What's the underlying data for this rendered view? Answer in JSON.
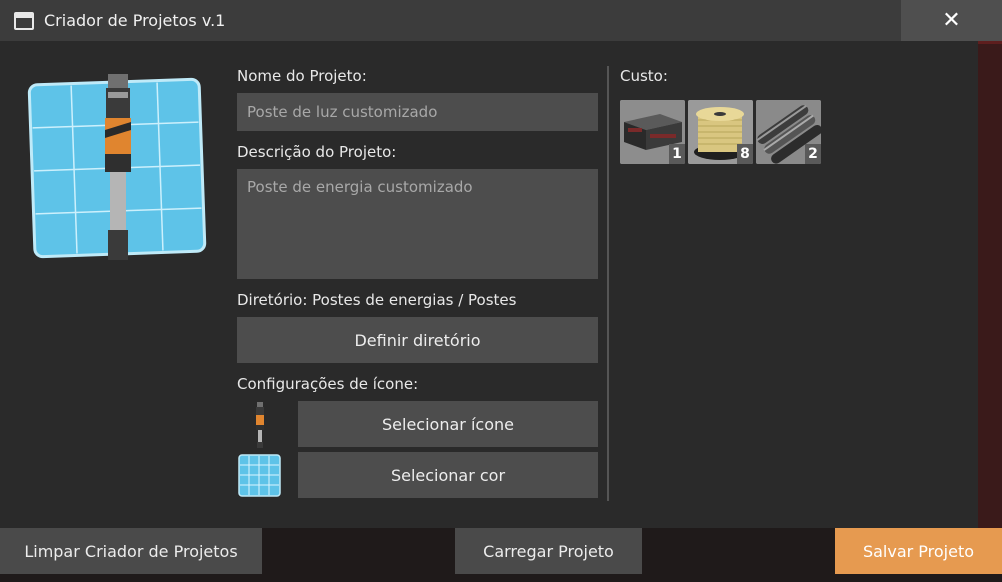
{
  "window": {
    "title": "Criador de Projetos v.1",
    "close_label": "✕"
  },
  "form": {
    "name_label": "Nome do Projeto:",
    "name_value": "Poste de luz customizado",
    "description_label": "Descrição do Projeto:",
    "description_value": "Poste de energia customizado",
    "directory_label": "Diretório: Postes de energias / Postes",
    "define_directory_button": "Definir diretório",
    "icon_settings_label": "Configurações de ícone:",
    "select_icon_button": "Selecionar ícone",
    "select_color_button": "Selecionar cor"
  },
  "cost": {
    "label": "Custo:",
    "items": [
      {
        "icon": "steel-beam-icon",
        "count": "1"
      },
      {
        "icon": "wire-spool-icon",
        "count": "8"
      },
      {
        "icon": "metal-pipes-icon",
        "count": "2"
      }
    ]
  },
  "footer": {
    "clear_button": "Limpar Criador de Projetos",
    "load_button": "Carregar Projeto",
    "save_button": "Salvar Projeto"
  },
  "colors": {
    "accent": "#e69a50",
    "blueprint": "#4fb3d9",
    "panel": "#2a2a2a",
    "field": "#4d4d4d"
  }
}
